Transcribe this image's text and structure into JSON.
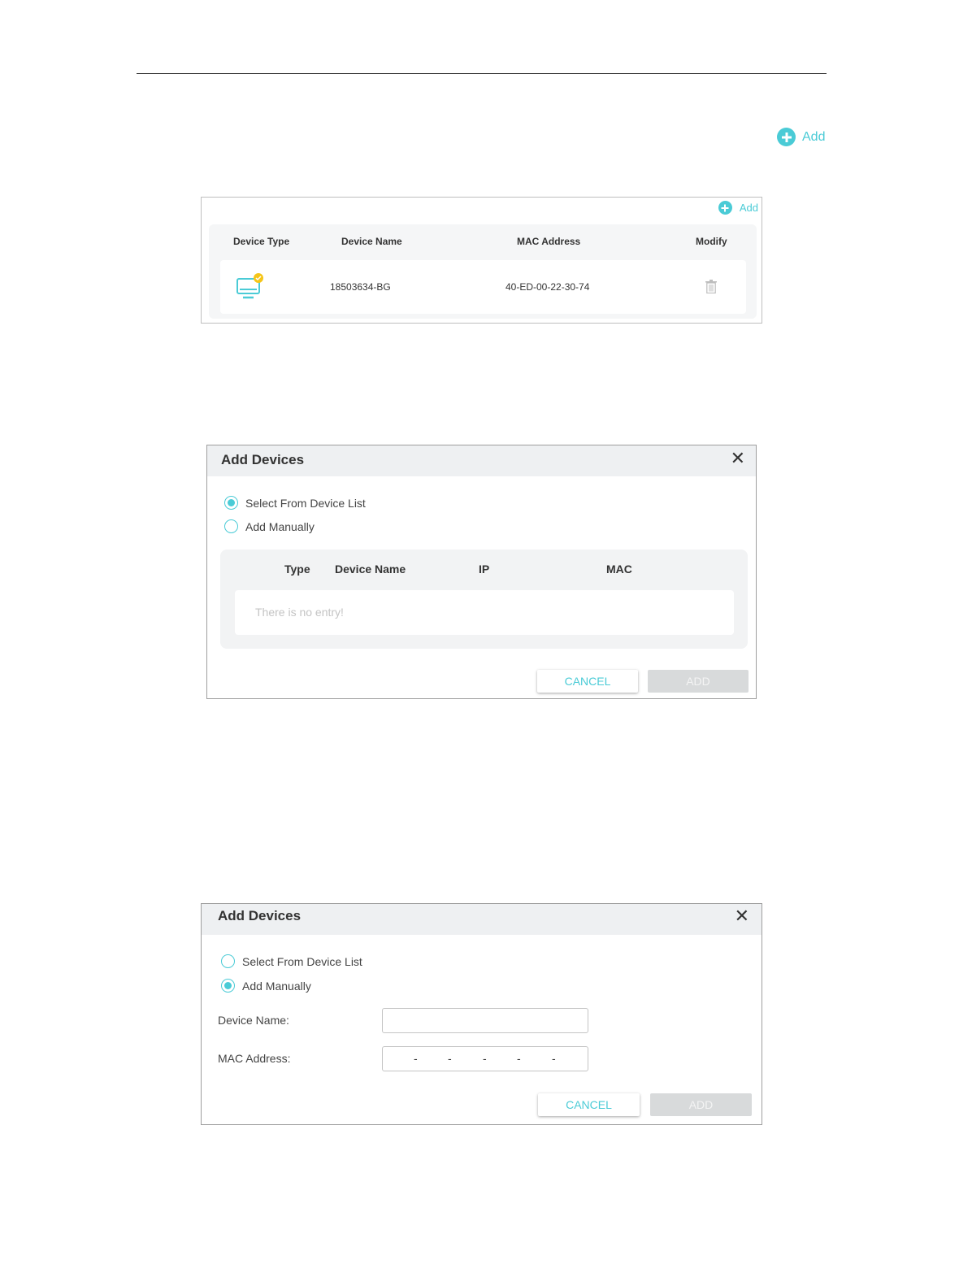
{
  "page": {
    "top_add_label": "Add"
  },
  "device_table": {
    "add_label": "Add",
    "headers": {
      "type": "Device Type",
      "name": "Device Name",
      "mac": "MAC Address",
      "modify": "Modify"
    },
    "rows": [
      {
        "icon": "pc-device-icon",
        "name": "18503634-BG",
        "mac": "40-ED-00-22-30-74",
        "action_icon": "trash-icon"
      }
    ]
  },
  "dialog_list": {
    "title": "Add Devices",
    "options": [
      "Select From Device List",
      "Add Manually"
    ],
    "selected": "Select From Device List",
    "headers": {
      "type": "Type",
      "name": "Device Name",
      "ip": "IP",
      "mac": "MAC"
    },
    "empty_text": "There is no entry!",
    "cancel": "CANCEL",
    "add": "ADD"
  },
  "dialog_manual": {
    "title": "Add Devices",
    "options": [
      "Select From Device List",
      "Add Manually"
    ],
    "selected": "Add Manually",
    "device_name_label": "Device Name:",
    "device_name_value": "",
    "mac_label": "MAC Address:",
    "mac_separator": "-",
    "cancel": "CANCEL",
    "add": "ADD"
  },
  "colors": {
    "accent": "#4acbd6",
    "disabled": "#d8dadb",
    "device_badge": "#f5c518"
  }
}
